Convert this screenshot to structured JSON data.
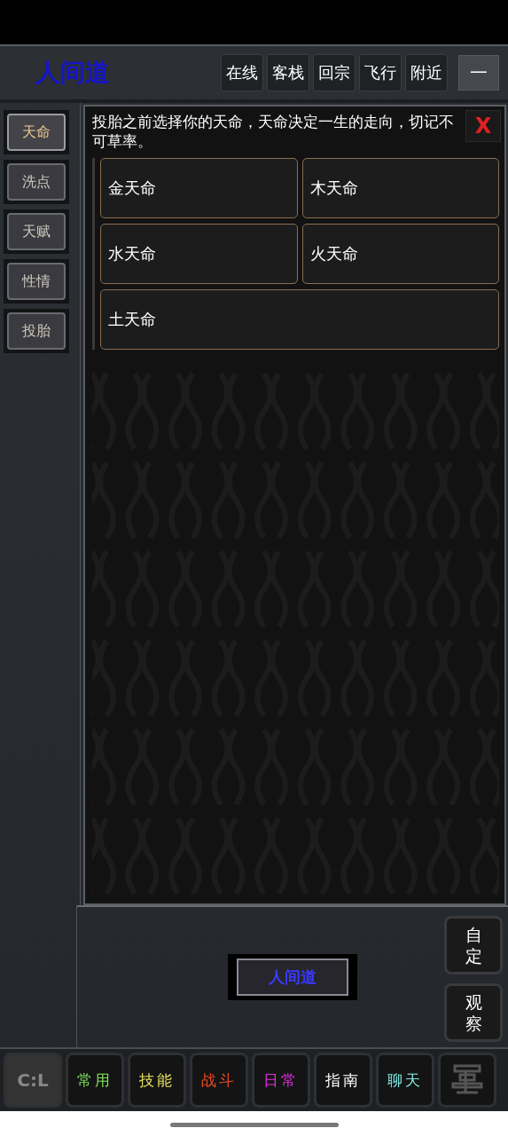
{
  "header": {
    "title": "人间道",
    "buttons": [
      "在线",
      "客栈",
      "回宗",
      "飞行",
      "附近"
    ],
    "minimize": "一"
  },
  "sidebar": {
    "tabs": [
      {
        "label": "天命",
        "selected": true
      },
      {
        "label": "洗点",
        "selected": false
      },
      {
        "label": "天赋",
        "selected": false
      },
      {
        "label": "性情",
        "selected": false
      },
      {
        "label": "投胎",
        "selected": false
      }
    ]
  },
  "panel": {
    "description": "投胎之前选择你的天命，天命决定一生的走向，切记不可草率。",
    "close": "X",
    "options": [
      {
        "label": "金天命",
        "wide": false
      },
      {
        "label": "木天命",
        "wide": false
      },
      {
        "label": "水天命",
        "wide": false
      },
      {
        "label": "火天命",
        "wide": false
      },
      {
        "label": "土天命",
        "wide": true
      }
    ]
  },
  "location_button": "人间道",
  "side_buttons": [
    "自定",
    "观察"
  ],
  "bottom_bar": [
    {
      "kind": "icon",
      "label": "C:L"
    },
    {
      "kind": "text",
      "label": "常用",
      "color": "#7ee05a"
    },
    {
      "kind": "text",
      "label": "技能",
      "color": "#e8e060"
    },
    {
      "kind": "text",
      "label": "战斗",
      "color": "#f04a20"
    },
    {
      "kind": "text",
      "label": "日常",
      "color": "#e030e0"
    },
    {
      "kind": "text",
      "label": "指南",
      "color": "#ffffff"
    },
    {
      "kind": "text",
      "label": "聊天",
      "color": "#80e8e0"
    },
    {
      "kind": "glyph"
    }
  ]
}
